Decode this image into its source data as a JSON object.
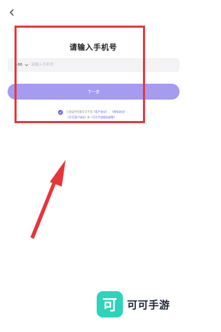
{
  "header": {
    "back_icon": "chevron-left-icon"
  },
  "title": "请输入手机号",
  "phone": {
    "country_code": "+86",
    "country_chevron_icon": "chevron-down-icon",
    "placeholder": "请输入手机号"
  },
  "next_button": {
    "label": "下一步",
    "color": "#a59bf1"
  },
  "agreement": {
    "checked": true,
    "check_color": "#6a5cf0",
    "text_1": "已阅读并同意可可手游",
    "link_1": "《用户协议》",
    "text_2": "、",
    "link_2": "《隐私协议》",
    "text_3": "、",
    "link_3": "《可可用户协议》",
    "text_4": "和",
    "link_4": "《可可手游隐私政策》"
  },
  "annotation": {
    "box_color": "#e8343a",
    "arrow_color": "#e8343a"
  },
  "watermark": {
    "icon_glyph": "可",
    "icon_color": "#2ed3bb",
    "text": "可可手游"
  }
}
